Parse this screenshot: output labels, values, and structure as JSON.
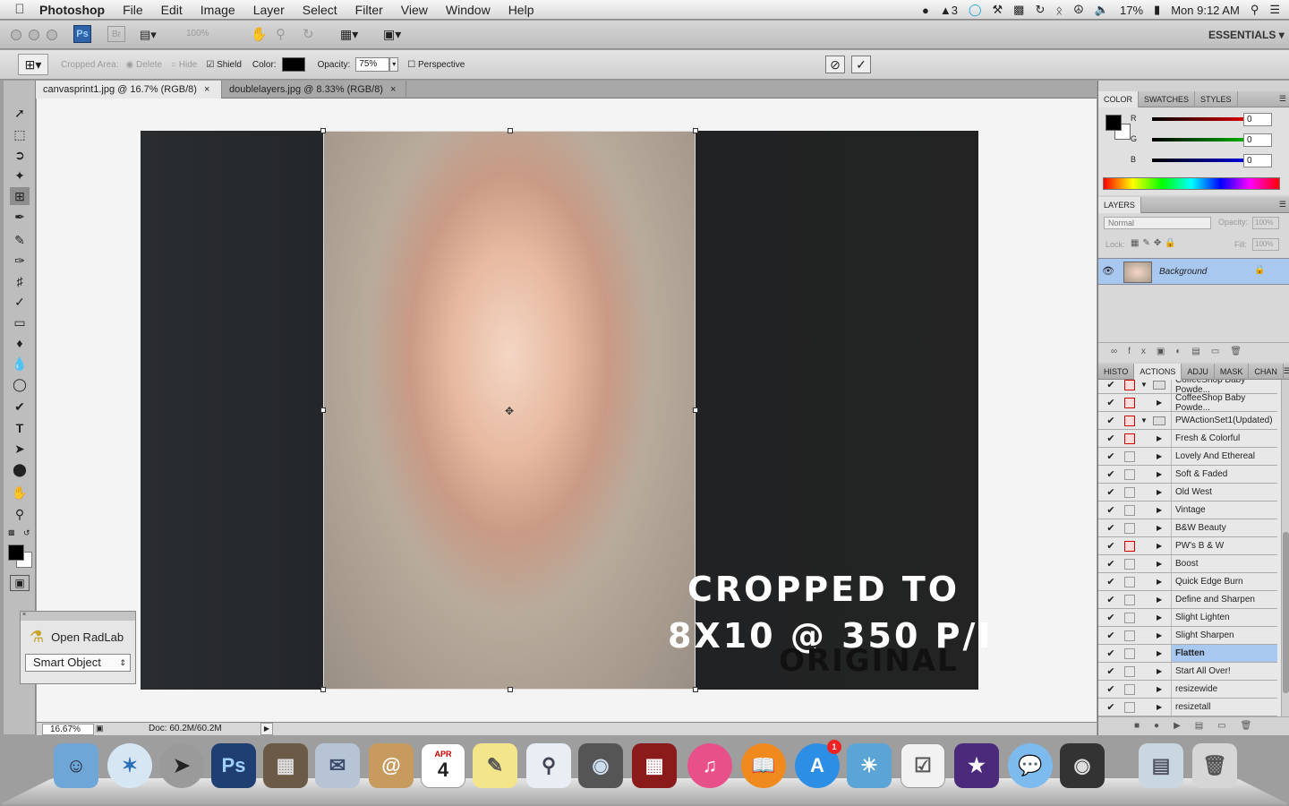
{
  "menubar": {
    "app_name": "Photoshop",
    "items": [
      "File",
      "Edit",
      "Image",
      "Layer",
      "Select",
      "Filter",
      "View",
      "Window",
      "Help"
    ],
    "status_icons": [
      "creative-cloud-icon",
      "adobe-icon",
      "sync-icon",
      "tools-icon",
      "display-icon",
      "screen-icon",
      "time-machine-icon",
      "bluetooth-icon",
      "wifi-icon",
      "volume-icon"
    ],
    "adobe_count": "3",
    "battery": "17%",
    "clock": "Mon 9:12 AM"
  },
  "appbar": {
    "ps_badge": "Ps",
    "br_badge": "Br",
    "zoom": "100%",
    "workspace": "ESSENTIALS"
  },
  "options": {
    "cropped_area_label": "Cropped Area:",
    "delete_label": "Delete",
    "hide_label": "Hide",
    "shield_label": "Shield",
    "color_label": "Color:",
    "opacity_label": "Opacity:",
    "opacity_value": "75%",
    "perspective_label": "Perspective",
    "shield_color": "#000000"
  },
  "tabs": [
    {
      "label": "canvasprint1.jpg @ 16.7% (RGB/8)",
      "close": "×"
    },
    {
      "label": "doublelayers.jpg @ 8.33% (RGB/8)",
      "close": "×"
    }
  ],
  "canvas": {
    "overlay_line1": "CROPPED TO",
    "overlay_line2": "8X10 @ 350 P/I",
    "watermark": "ORIGINAL"
  },
  "status": {
    "zoom": "16.67%",
    "doc": "Doc: 60.2M/60.2M"
  },
  "radlab": {
    "button": "Open RadLab",
    "select": "Smart Object"
  },
  "color_panel": {
    "tabs": [
      "COLOR",
      "SWATCHES",
      "STYLES"
    ],
    "r_label": "R",
    "g_label": "G",
    "b_label": "B",
    "r": "0",
    "g": "0",
    "b": "0"
  },
  "layers_panel": {
    "title": "LAYERS",
    "blend": "Normal",
    "opacity_label": "Opacity:",
    "opacity": "100%",
    "lock_label": "Lock:",
    "fill_label": "Fill:",
    "fill": "100%",
    "layer_name": "Background"
  },
  "actions_panel": {
    "tabs": [
      "HISTO",
      "ACTIONS",
      "ADJU",
      "MASK",
      "CHAN"
    ],
    "rows": [
      {
        "name": "CoffeeShop Baby Powde...",
        "folder": true,
        "red": true
      },
      {
        "name": "CoffeeShop Baby Powde...",
        "folder": false,
        "red": true
      },
      {
        "name": "PWActionSet1(Updated)",
        "folder": true,
        "red": true
      },
      {
        "name": "Fresh & Colorful",
        "folder": false,
        "red": true
      },
      {
        "name": "Lovely And Ethereal",
        "folder": false,
        "red": false
      },
      {
        "name": "Soft & Faded",
        "folder": false,
        "red": false
      },
      {
        "name": "Old West",
        "folder": false,
        "red": false
      },
      {
        "name": "Vintage",
        "folder": false,
        "red": false
      },
      {
        "name": "B&W Beauty",
        "folder": false,
        "red": false
      },
      {
        "name": "PW's B & W",
        "folder": false,
        "red": true
      },
      {
        "name": "Boost",
        "folder": false,
        "red": false
      },
      {
        "name": "Quick Edge Burn",
        "folder": false,
        "red": false
      },
      {
        "name": "Define and Sharpen",
        "folder": false,
        "red": false
      },
      {
        "name": "Slight Lighten",
        "folder": false,
        "red": false
      },
      {
        "name": "Slight Sharpen",
        "folder": false,
        "red": false
      },
      {
        "name": "Flatten",
        "folder": false,
        "red": false,
        "selected": true
      },
      {
        "name": "Start All Over!",
        "folder": false,
        "red": false
      },
      {
        "name": "resizewide",
        "folder": false,
        "red": false
      },
      {
        "name": "resizetall",
        "folder": false,
        "red": false
      }
    ]
  },
  "dock": {
    "calendar_day": "4",
    "calendar_month": "APR",
    "appstore_badge": "1",
    "items": [
      "finder",
      "safari",
      "launchpad",
      "photoshop",
      "photo-booth-strip",
      "mail-stamp",
      "address-book",
      "calendar",
      "stickies",
      "preview",
      "facetime",
      "photo-booth",
      "itunes",
      "ibooks",
      "app-store",
      "iphoto",
      "reminders",
      "imovie",
      "messages",
      "photo-camera",
      "documents",
      "trash"
    ]
  }
}
